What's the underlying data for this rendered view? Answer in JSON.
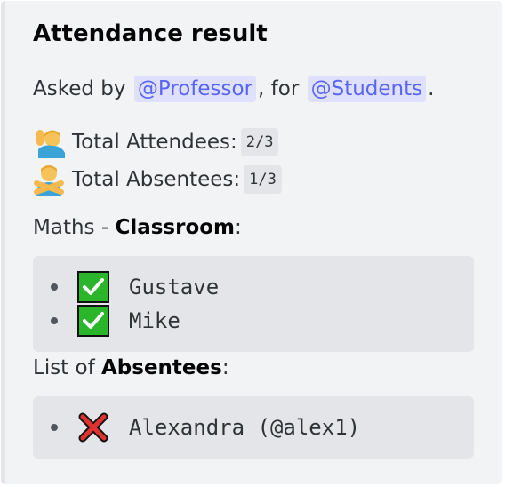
{
  "embed": {
    "title": "Attendance result",
    "asked_prefix": "Asked by ",
    "asker_mention": "@Professor",
    "for_text": ", for ",
    "target_mention": "@Students",
    "period": ".",
    "attendees_label": "Total Attendees:",
    "attendees_value": "2/3",
    "absentees_label": "Total Absentees:",
    "absentees_value": "1/3",
    "subject_prefix": "Maths - ",
    "subject_room": "Classroom",
    "subject_suffix": ":",
    "present_list": [
      {
        "name": "Gustave",
        "icon": "check-icon"
      },
      {
        "name": "Mike",
        "icon": "check-icon"
      }
    ],
    "absentees_prefix": "List of ",
    "absentees_bold": "Absentees",
    "absentees_suffix": ":",
    "absent_list": [
      {
        "name": "Alexandra (@alex1)",
        "icon": "cross-icon"
      }
    ]
  },
  "colors": {
    "embed_background": "#f2f3f5",
    "mention_background": "#dee0fc",
    "mention_text": "#5865f2",
    "check_green": "#2ab52a",
    "cross_red": "#e0332f"
  }
}
